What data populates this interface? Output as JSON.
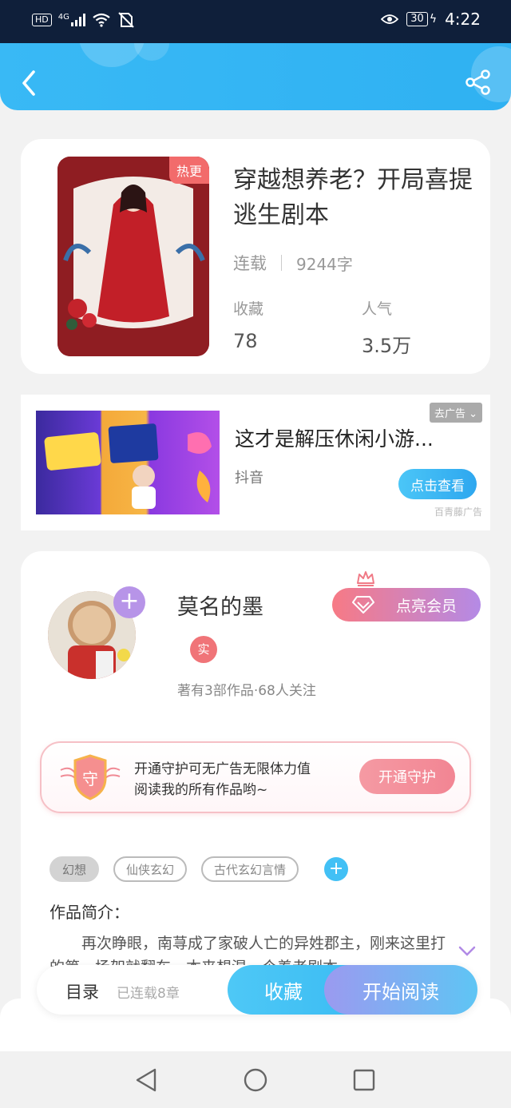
{
  "status_bar": {
    "left_icons": [
      "HD",
      "4G",
      "signal-icon",
      "wifi-icon",
      "no-sim-icon"
    ],
    "hd": "HD",
    "network": "4G",
    "battery": "30",
    "time": "4:22"
  },
  "header": {
    "back_icon": "chevron-left-icon",
    "share_icon": "share-icon"
  },
  "book": {
    "badge": "热更",
    "title": "穿越想养老？开局喜提逃生剧本",
    "status": "连载",
    "word_count": "9244字",
    "stats": [
      {
        "label": "收藏",
        "value": "78"
      },
      {
        "label": "人气",
        "value": "3.5万"
      }
    ]
  },
  "ad": {
    "close_label": "去广告",
    "title": "这才是解压休闲小游...",
    "source": "抖音",
    "button": "点击查看",
    "provider": "百青藤广告"
  },
  "author": {
    "name": "莫名的墨",
    "real_badge": "实",
    "stats": "著有3部作品·68人关注",
    "vip_button": "点亮会员",
    "guard": {
      "icon_char": "守",
      "text_line1": "开通守护可无广告无限体力值",
      "text_line2": "阅读我的所有作品哟~",
      "button": "开通守护"
    },
    "tags": [
      "幻想",
      "仙侠玄幻",
      "古代玄幻言情"
    ],
    "intro_title": "作品简介：",
    "intro_text": "再次睁眼，南荨成了家破人亡的异姓郡主，刚来这里打的第一场架就翻车，本来想混一个养老剧本"
  },
  "bottom_bar": {
    "toc": "目录",
    "toc_sub": "已连载8章",
    "favorite": "收藏",
    "read": "开始阅读"
  },
  "colors": {
    "accent_blue": "#39b9f5",
    "hot_red": "#f26b6b",
    "vip_gradient_start": "#f77a85",
    "vip_gradient_end": "#b48ae6"
  }
}
